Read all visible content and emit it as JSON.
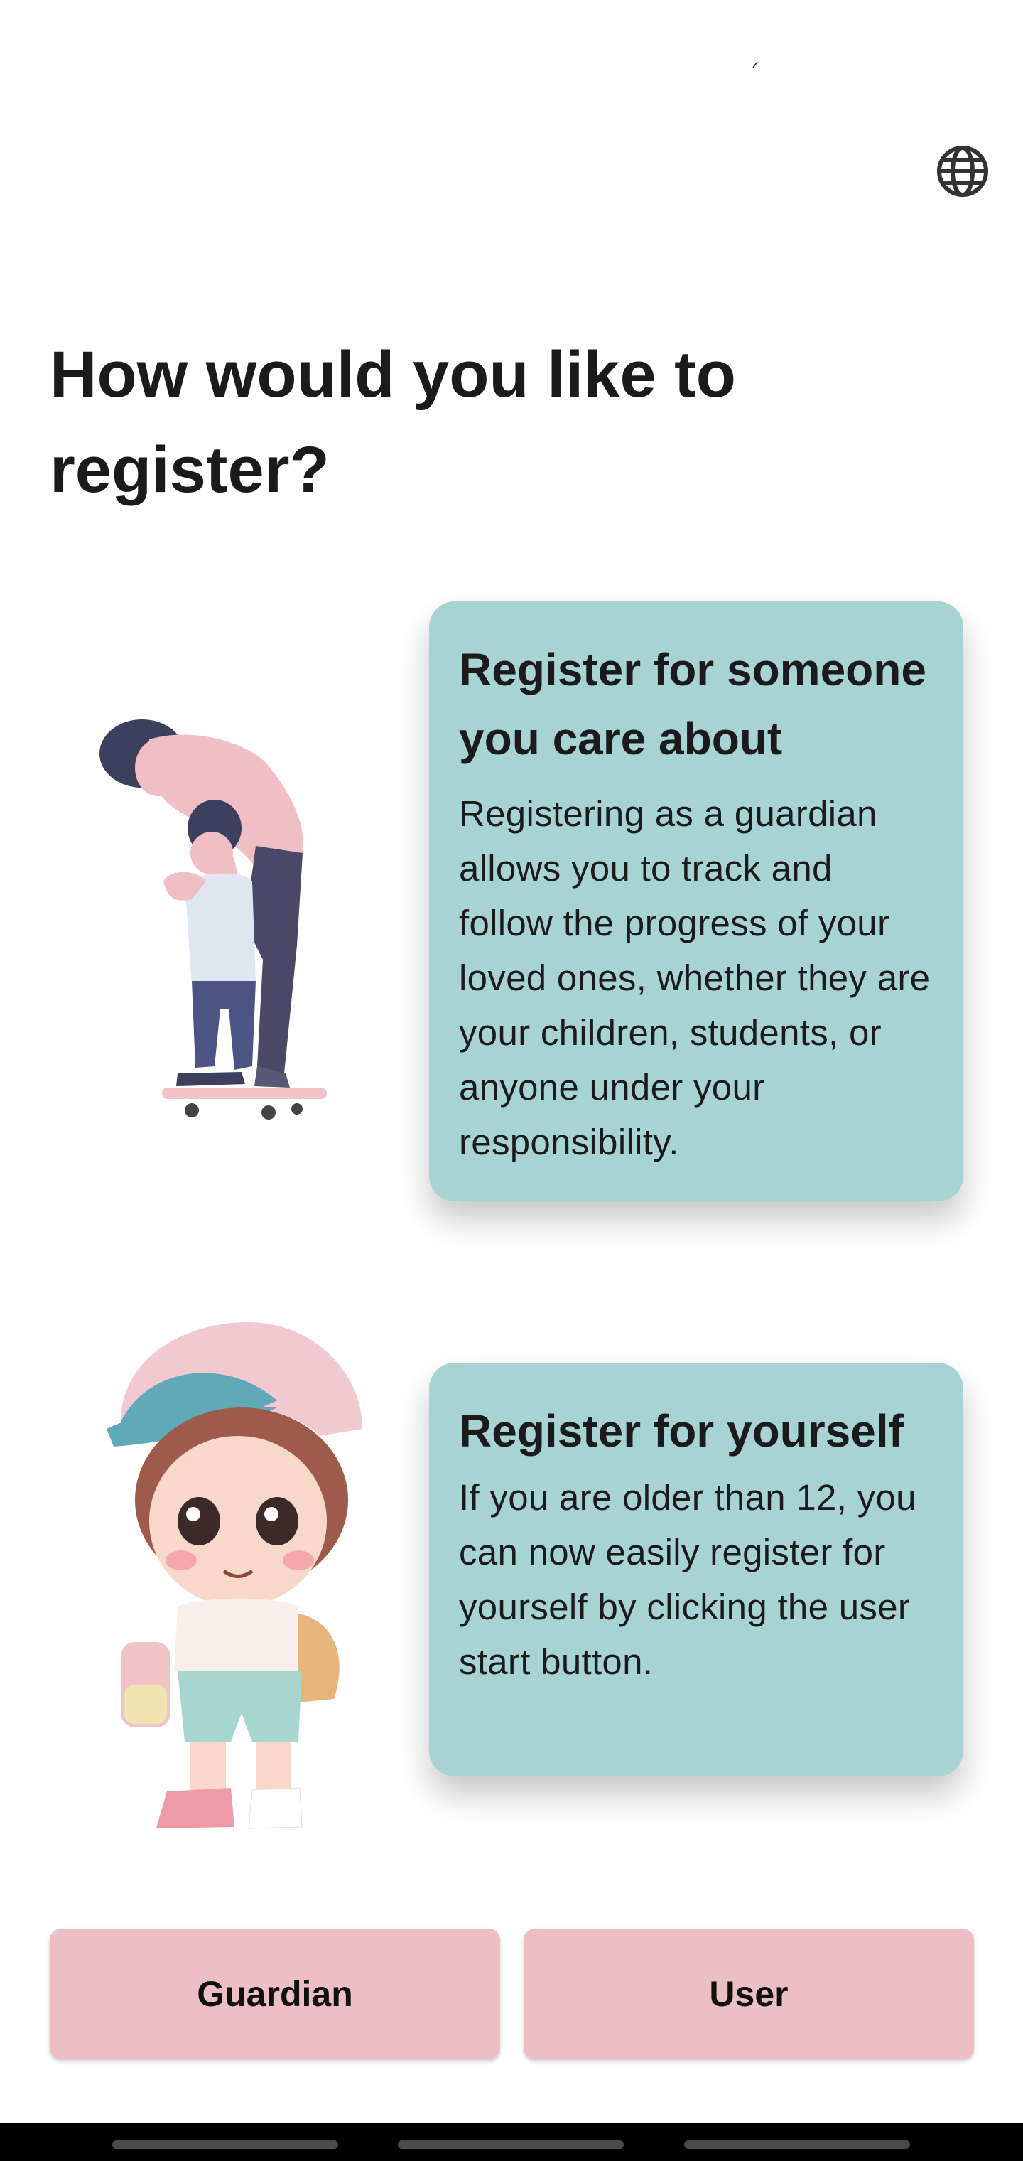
{
  "header": {
    "language_icon": "globe-icon"
  },
  "page": {
    "title": "How would you like to register?"
  },
  "cards": [
    {
      "heading": "Register for someone you care about",
      "body": "Registering as a guardian allows you to track and follow the progress of your loved ones, whether they are your children, students, or anyone under your responsibility.",
      "illustration": "guardian-with-child-illustration"
    },
    {
      "heading": "Register for yourself",
      "body": "If you are older than 12, you can now easily register for yourself by clicking the user start button.",
      "illustration": "child-character-illustration"
    }
  ],
  "buttons": {
    "guardian": "Guardian",
    "user": "User"
  },
  "colors": {
    "card_bg": "#a8d3d3",
    "button_bg": "#ecbfc6",
    "text": "#1b1b1d"
  }
}
